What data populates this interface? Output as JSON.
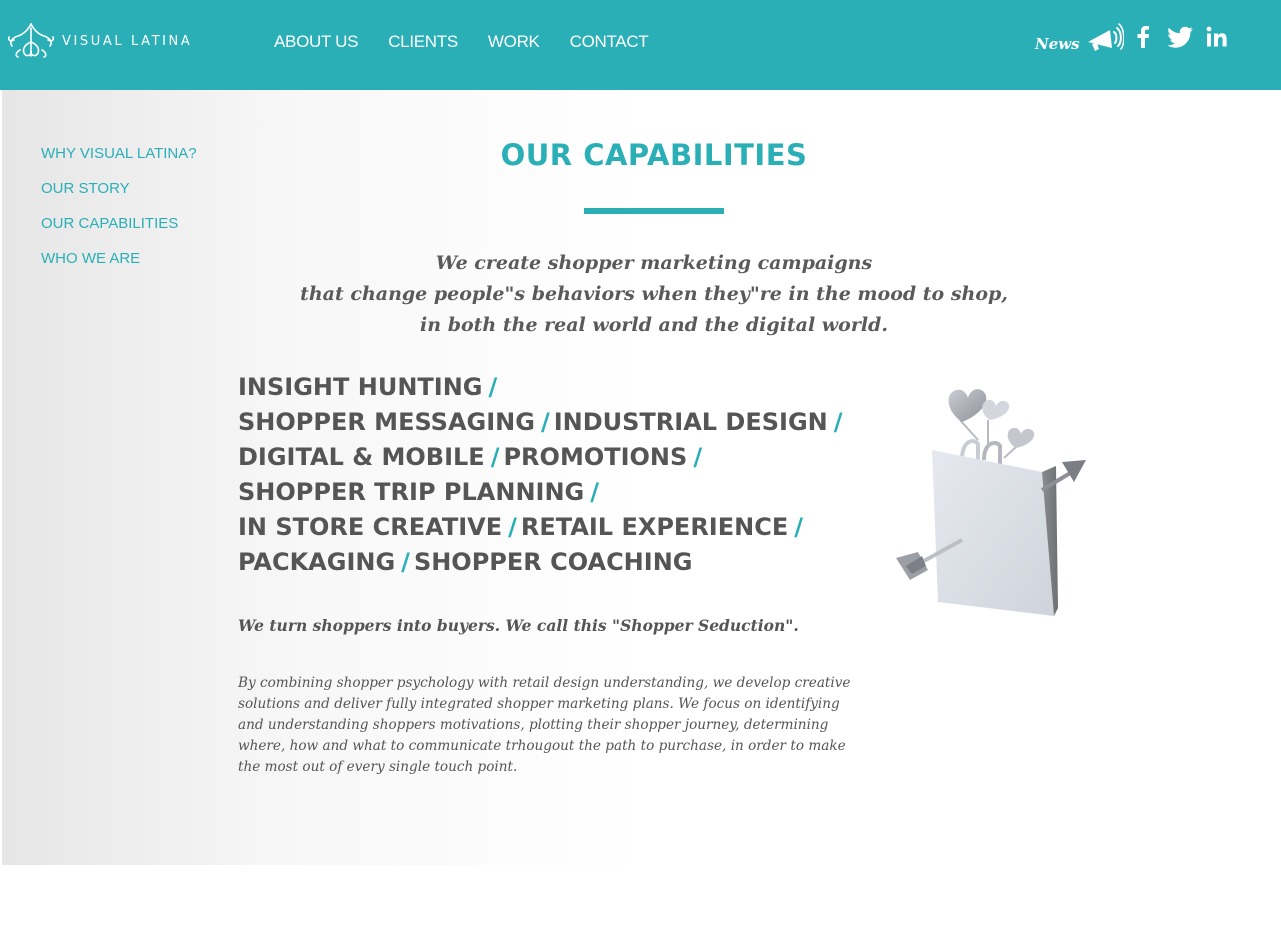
{
  "header": {
    "logo_text": "VISUAL LATINA",
    "nav": [
      "ABOUT US",
      "CLIENTS",
      "WORK",
      "CONTACT"
    ],
    "news_label": "News",
    "social_icons": [
      "megaphone-icon",
      "facebook-icon",
      "twitter-icon",
      "linkedin-icon"
    ]
  },
  "sidebar": {
    "items": [
      "WHY VISUAL LATINA?",
      "OUR STORY",
      "OUR CAPABILITIES",
      "WHO WE ARE"
    ]
  },
  "main": {
    "title": "OUR CAPABILITIES",
    "intro": [
      "We create shopper marketing campaigns",
      "that change people\"s behaviors when they\"re in the mood to shop,",
      "in both the real world and the digital world."
    ],
    "capability_lines": [
      {
        "items": [
          "INSIGHT HUNTING"
        ]
      },
      {
        "items": [
          "SHOPPER MESSAGING",
          "INDUSTRIAL DESIGN"
        ]
      },
      {
        "items": [
          "DIGITAL & MOBILE",
          "PROMOTIONS"
        ]
      },
      {
        "items": [
          "SHOPPER TRIP PLANNING"
        ]
      },
      {
        "items": [
          "IN STORE CREATIVE",
          "RETAIL EXPERIENCE"
        ]
      },
      {
        "items": [
          "PACKAGING",
          "SHOPPER COACHING"
        ]
      }
    ],
    "separator": "/",
    "tagline": "We turn shoppers into buyers. We call this \"Shopper Seduction\".",
    "body": "By combining shopper psychology with retail design understanding, we develop creative solutions and deliver fully integrated shopper marketing plans. We focus on identifying and understanding shoppers motivations, plotting their shopper journey, determining where, how and what to communicate trhougout the path to purchase, in order to make the most out of every single touch point."
  },
  "colors": {
    "brand": "#2aafb7",
    "text": "#555555"
  }
}
